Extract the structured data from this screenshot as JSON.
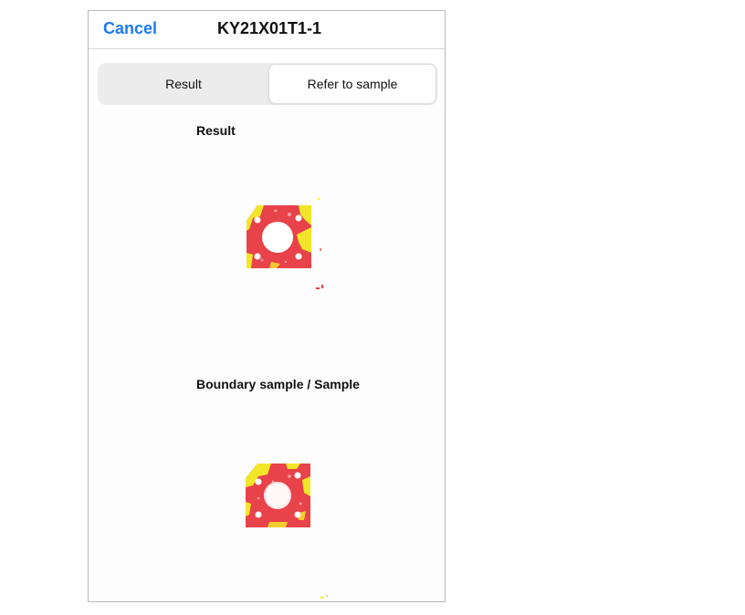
{
  "navbar": {
    "cancel_label": "Cancel",
    "title": "KY21X01T1-1"
  },
  "segmented_control": {
    "items": [
      {
        "label": "Result",
        "selected": false
      },
      {
        "label": "Refer to sample",
        "selected": true
      }
    ]
  },
  "sections": {
    "result_label": "Result",
    "boundary_label": "Boundary sample / Sample"
  },
  "colors": {
    "accent": "#1a7bf0",
    "part_red": "#e8424a",
    "part_yellow": "#f2e62a"
  }
}
